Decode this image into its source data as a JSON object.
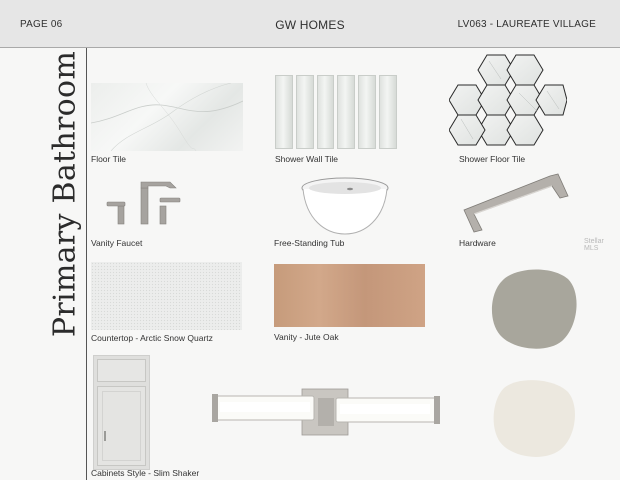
{
  "header": {
    "page_label": "PAGE 06",
    "brand": "GW HOMES",
    "project": "LV063 - LAUREATE VILLAGE"
  },
  "section_title": "Primary Bathroom",
  "watermark": "Stellar MLS",
  "items": [
    {
      "label": "Floor Tile"
    },
    {
      "label": "Shower Wall Tile"
    },
    {
      "label": "Shower Floor Tile"
    },
    {
      "label": "Vanity Faucet"
    },
    {
      "label": "Free-Standing Tub"
    },
    {
      "label": "Hardware"
    },
    {
      "label": "Countertop - Arctic Snow Quartz"
    },
    {
      "label": "Vanity -  Jute Oak"
    },
    {
      "label": "Cabinets Style - Slim Shaker"
    }
  ],
  "colors": {
    "header_bg": "#e6e6e6",
    "page_bg": "#f7f7f6",
    "paint_swatch_1": "#a8a69c",
    "paint_swatch_2": "#ece8df",
    "vanity_wood": "#c99e7e",
    "brushed_nickel": "#a6a39f"
  }
}
